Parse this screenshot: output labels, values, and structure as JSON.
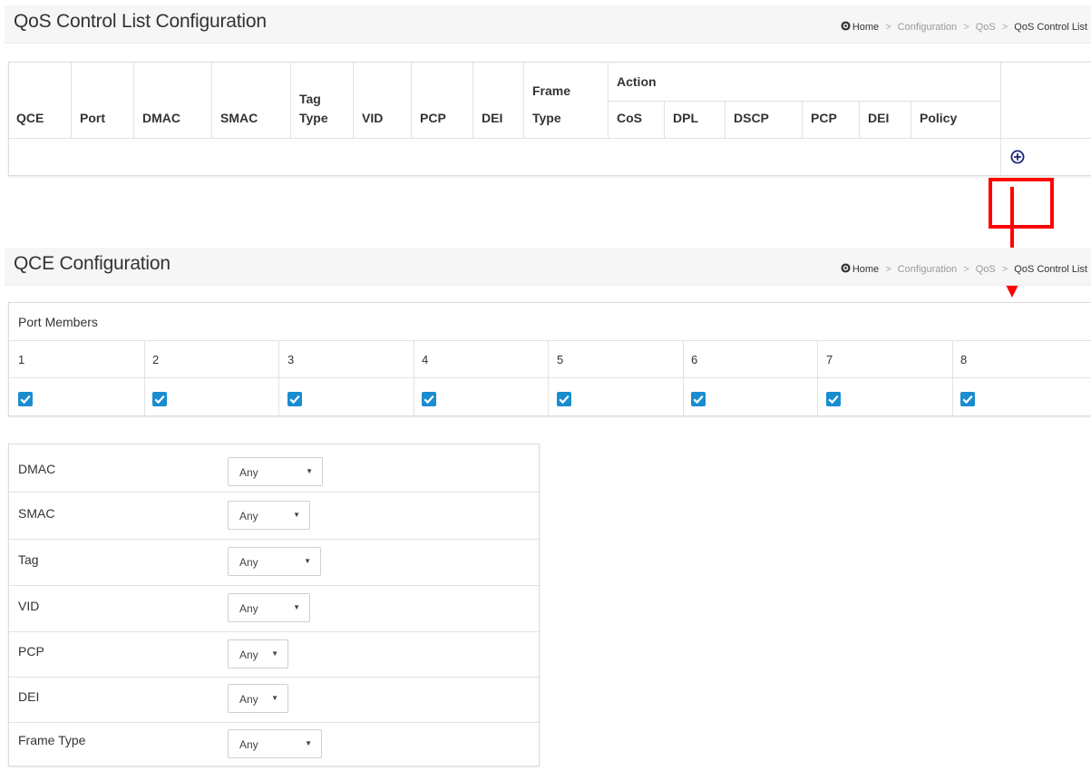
{
  "qcl_panel": {
    "title": "QoS Control List Configuration",
    "breadcrumb": {
      "home": "Home",
      "items": [
        "Configuration",
        "QoS"
      ],
      "current": "QoS Control List",
      "separator": ">"
    },
    "headers": {
      "qce": "QCE",
      "port": "Port",
      "dmac": "DMAC",
      "smac": "SMAC",
      "tag_type": [
        "Tag",
        "Type"
      ],
      "vid": "VID",
      "pcp": "PCP",
      "dei": "DEI",
      "frame_type": [
        "Frame",
        "Type"
      ],
      "action": "Action",
      "action_cols": [
        "CoS",
        "DPL",
        "DSCP",
        "PCP",
        "DEI",
        "Policy"
      ]
    },
    "add_icon": "add-circle-icon"
  },
  "annotation": {
    "color": "#ff0000"
  },
  "qce_panel": {
    "title": "QCE Configuration",
    "breadcrumb": {
      "home": "Home",
      "items": [
        "Configuration",
        "QoS"
      ],
      "current": "QoS Control List",
      "separator": ">"
    }
  },
  "port_members": {
    "title": "Port Members",
    "ports": [
      {
        "label": "1",
        "checked": true
      },
      {
        "label": "2",
        "checked": true
      },
      {
        "label": "3",
        "checked": true
      },
      {
        "label": "4",
        "checked": true
      },
      {
        "label": "5",
        "checked": true
      },
      {
        "label": "6",
        "checked": true
      },
      {
        "label": "7",
        "checked": true
      },
      {
        "label": "8",
        "checked": true
      }
    ],
    "checkbox_color": "#1a8cd0"
  },
  "filters": [
    {
      "label": "DMAC",
      "value": "Any"
    },
    {
      "label": "SMAC",
      "value": "Any"
    },
    {
      "label": "Tag",
      "value": "Any"
    },
    {
      "label": "VID",
      "value": "Any"
    },
    {
      "label": "PCP",
      "value": "Any"
    },
    {
      "label": "DEI",
      "value": "Any"
    },
    {
      "label": "Frame Type",
      "value": "Any"
    }
  ],
  "caret_glyph": "▼"
}
